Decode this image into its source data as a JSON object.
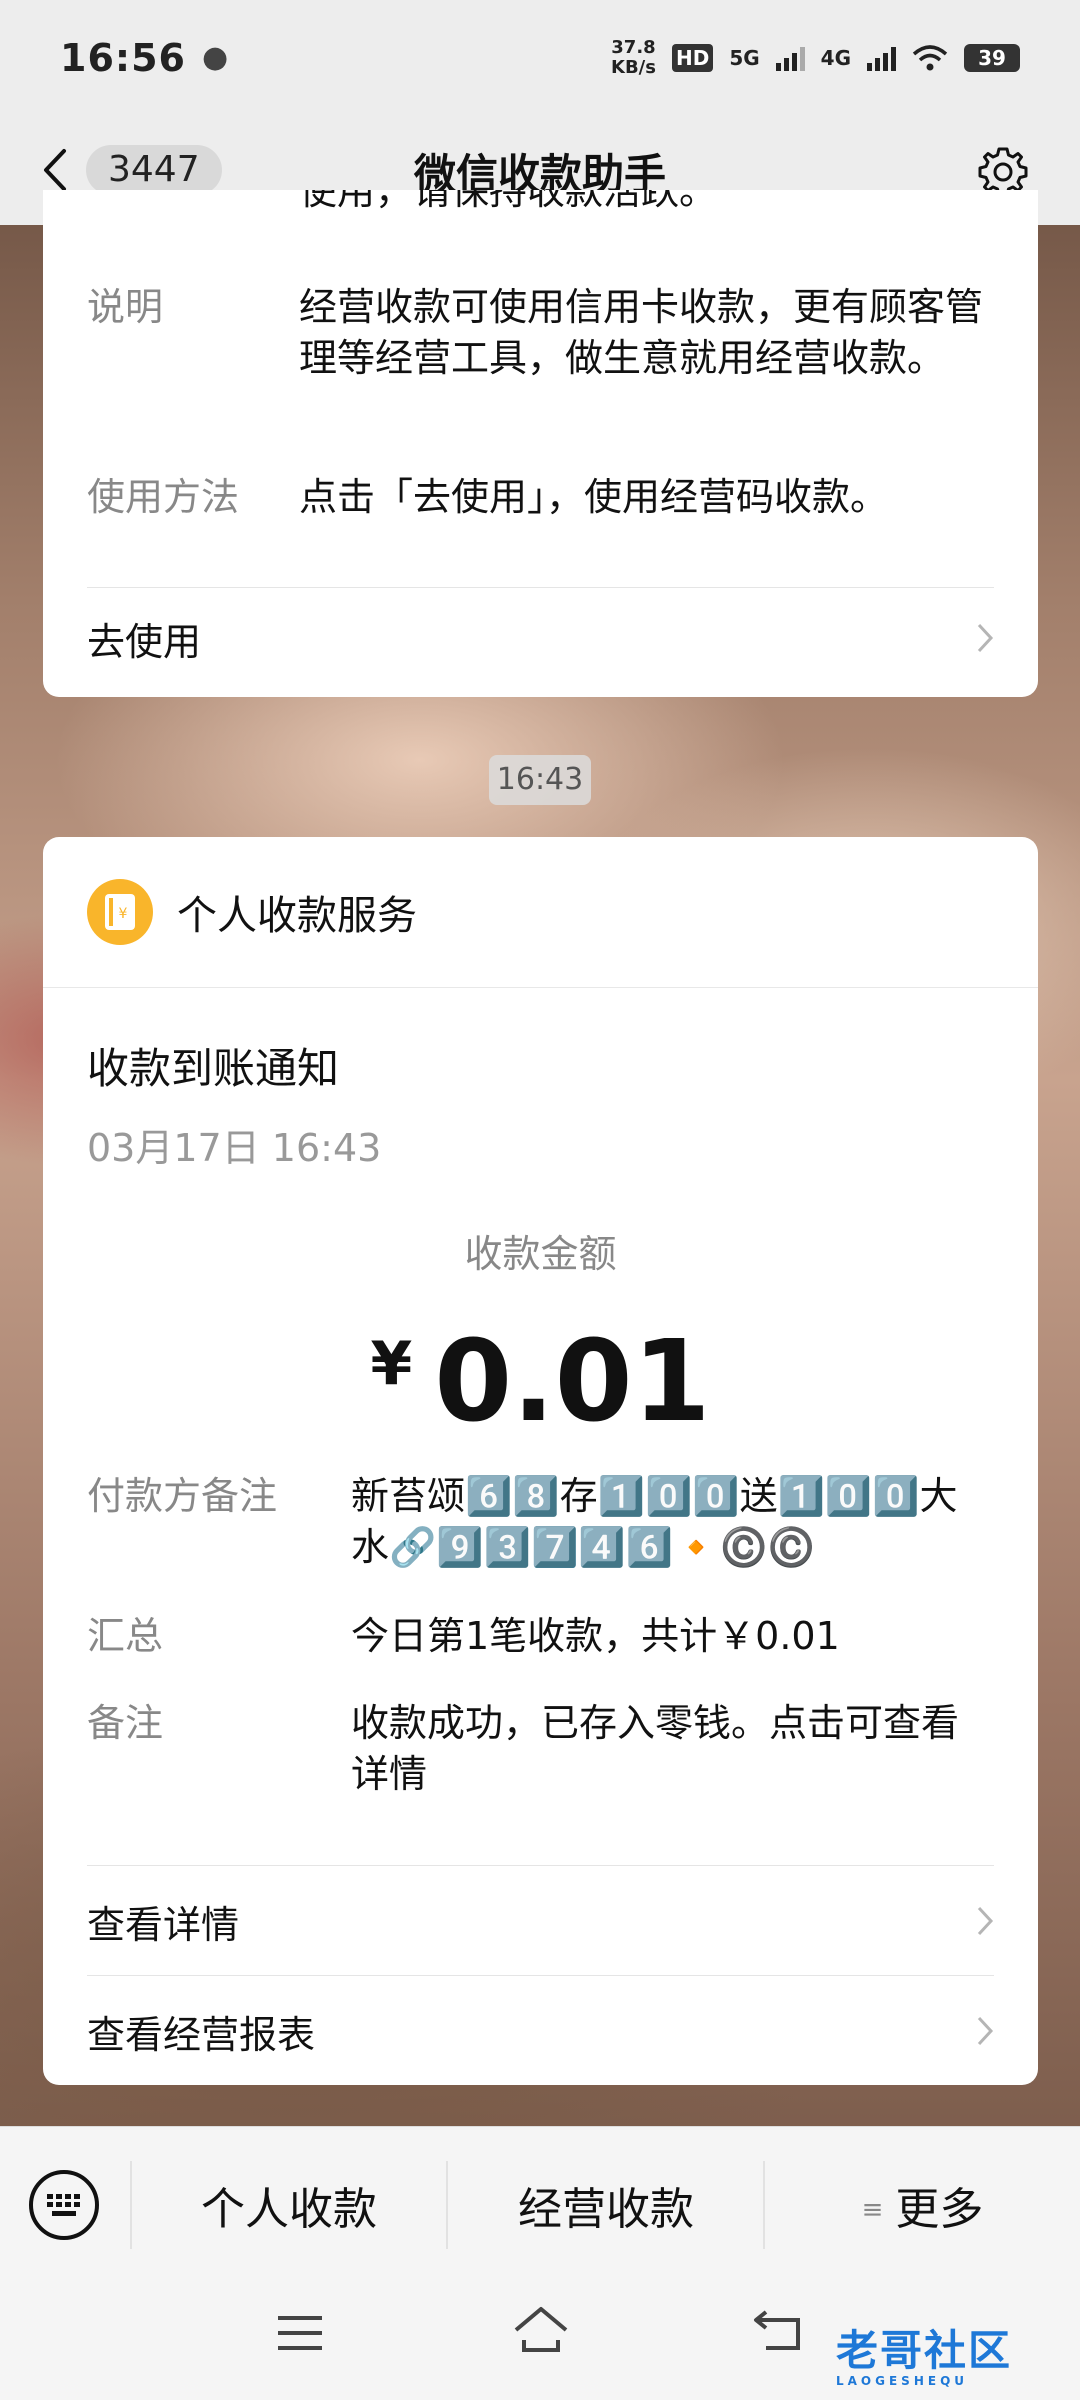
{
  "status_bar": {
    "time": "16:56",
    "net_speed_value": "37.8",
    "net_speed_unit": "KB/s",
    "hd_label": "HD",
    "sim1": "5G",
    "sim2": "4G",
    "battery": "39"
  },
  "header": {
    "back_count": "3447",
    "title": "微信收款助手"
  },
  "card_top": {
    "cut_text": "使用，请保持收款活跃。",
    "rows": [
      {
        "key": "说明",
        "value": "经营收款可使用信用卡收款，更有顾客管理等经营工具，做生意就用经营收款。"
      },
      {
        "key": "使用方法",
        "value": "点击「去使用」，使用经营码收款。"
      }
    ],
    "action": "去使用"
  },
  "timestamp_chip": "16:43",
  "card_main": {
    "service_name": "个人收款服务",
    "notice_title": "收款到账通知",
    "notice_time": "03月17日 16:43",
    "amount_label": "收款金额",
    "currency": "¥",
    "amount": "0.01",
    "rows": [
      {
        "key": "付款方备注",
        "value": "新苔颂6️⃣8️⃣存1️⃣0️⃣0️⃣送1️⃣0️⃣0️⃣大水🔗9️⃣3️⃣7️⃣4️⃣6️⃣🔸©️©️"
      },
      {
        "key": "汇总",
        "value": "今日第1笔收款，共计￥0.01"
      },
      {
        "key": "备注",
        "value": "收款成功，已存入零钱。点击可查看详情"
      }
    ],
    "actions": [
      "查看详情",
      "查看经营报表"
    ]
  },
  "bottom_menu": {
    "items": [
      "个人收款",
      "经营收款",
      "更多"
    ]
  },
  "watermark": {
    "text": "老哥社区",
    "sub": "LAOGESHEQU"
  }
}
